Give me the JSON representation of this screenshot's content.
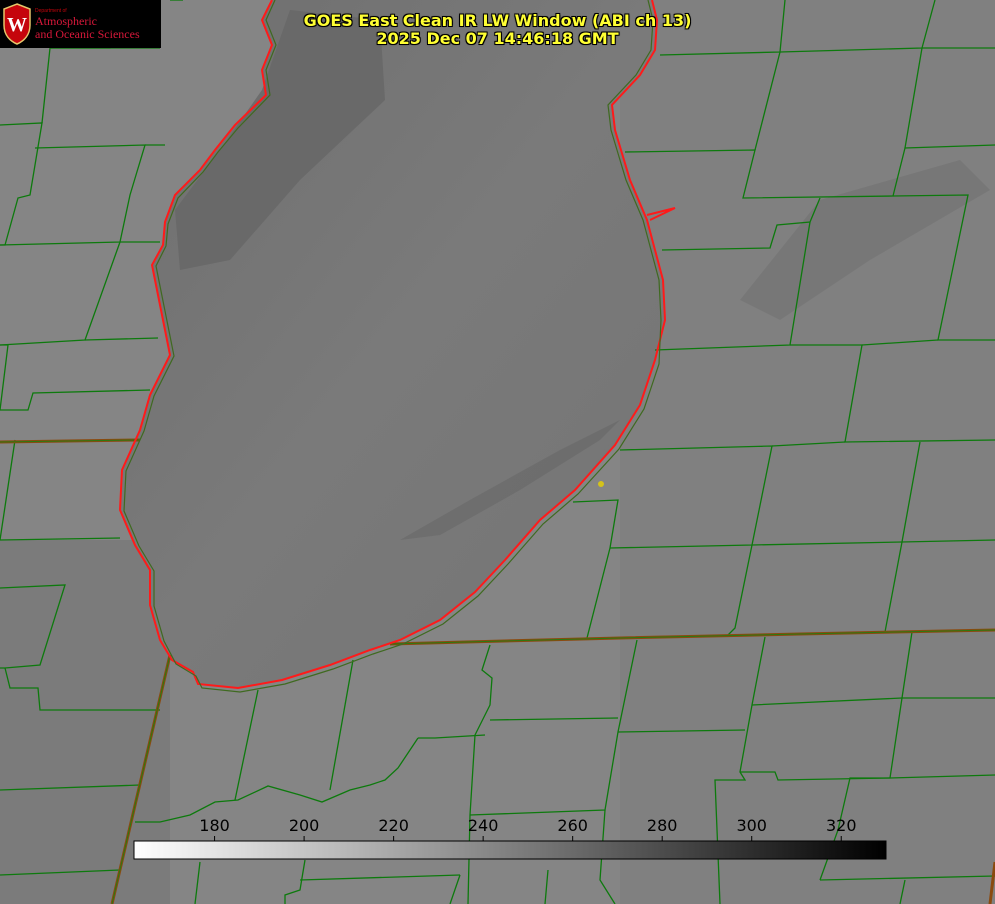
{
  "title": {
    "line1": "GOES East Clean IR LW Window (ABI ch 13)",
    "line2": "2025 Dec 07 14:46:18 GMT"
  },
  "logo": {
    "dept": "Department of",
    "line1": "Atmospheric",
    "line2": "and Oceanic Sciences",
    "crest_letter": "W"
  },
  "colorbar": {
    "min": 162,
    "max": 330,
    "ticks": [
      {
        "value": 180,
        "label": "180"
      },
      {
        "value": 200,
        "label": "200"
      },
      {
        "value": 220,
        "label": "220"
      },
      {
        "value": 240,
        "label": "240"
      },
      {
        "value": 260,
        "label": "260"
      },
      {
        "value": 280,
        "label": "280"
      },
      {
        "value": 300,
        "label": "300"
      },
      {
        "value": 320,
        "label": "320"
      }
    ],
    "color_low": "#ffffff",
    "color_high": "#000000"
  },
  "colors": {
    "county_lines": "#0d7a0d",
    "state_lines": "#8a4a10",
    "lake_shoreline": "#ff1a1a",
    "title_text": "#ffff33",
    "marker": "#d4c21a"
  }
}
